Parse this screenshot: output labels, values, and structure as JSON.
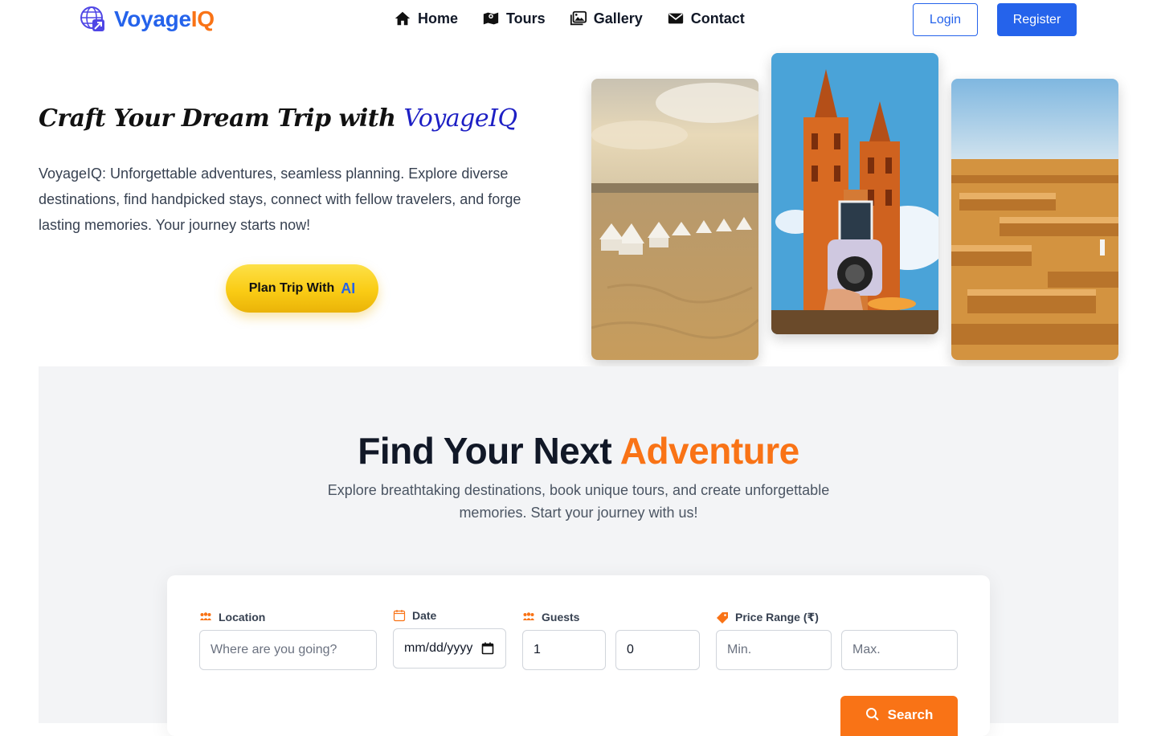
{
  "brand": {
    "name_part1": "Voyage",
    "name_part2": "IQ"
  },
  "nav": {
    "items": [
      {
        "label": "Home",
        "icon": "home-icon"
      },
      {
        "label": "Tours",
        "icon": "map-icon"
      },
      {
        "label": "Gallery",
        "icon": "gallery-icon"
      },
      {
        "label": "Contact",
        "icon": "envelope-icon"
      }
    ],
    "login_label": "Login",
    "register_label": "Register"
  },
  "hero": {
    "title_main": "Craft Your Dream Trip with ",
    "title_accent": "VoyageIQ",
    "description": "VoyageIQ: Unforgettable adventures, seamless planning. Explore diverse destinations, find handpicked stays, connect with fellow travelers, and forge lasting memories. Your journey starts now!",
    "cta_label": "Plan Trip With",
    "cta_accent": "AI"
  },
  "search_section": {
    "title_main": "Find Your Next ",
    "title_accent": "Adventure",
    "subtitle": "Explore breathtaking destinations, book unique tours, and create unforgettable memories. Start your journey with us!",
    "fields": {
      "location": {
        "label": "Location",
        "placeholder": "Where are you going?"
      },
      "date": {
        "label": "Date",
        "value": "mm/dd/yyyy"
      },
      "guests": {
        "label": "Guests",
        "adults": "1",
        "children": "0"
      },
      "price": {
        "label": "Price Range (₹)",
        "min_placeholder": "Min.",
        "max_placeholder": "Max."
      }
    },
    "search_label": "Search"
  },
  "colors": {
    "primary_blue": "#2563eb",
    "accent_orange": "#f97316",
    "cta_yellow": "#facc15"
  }
}
